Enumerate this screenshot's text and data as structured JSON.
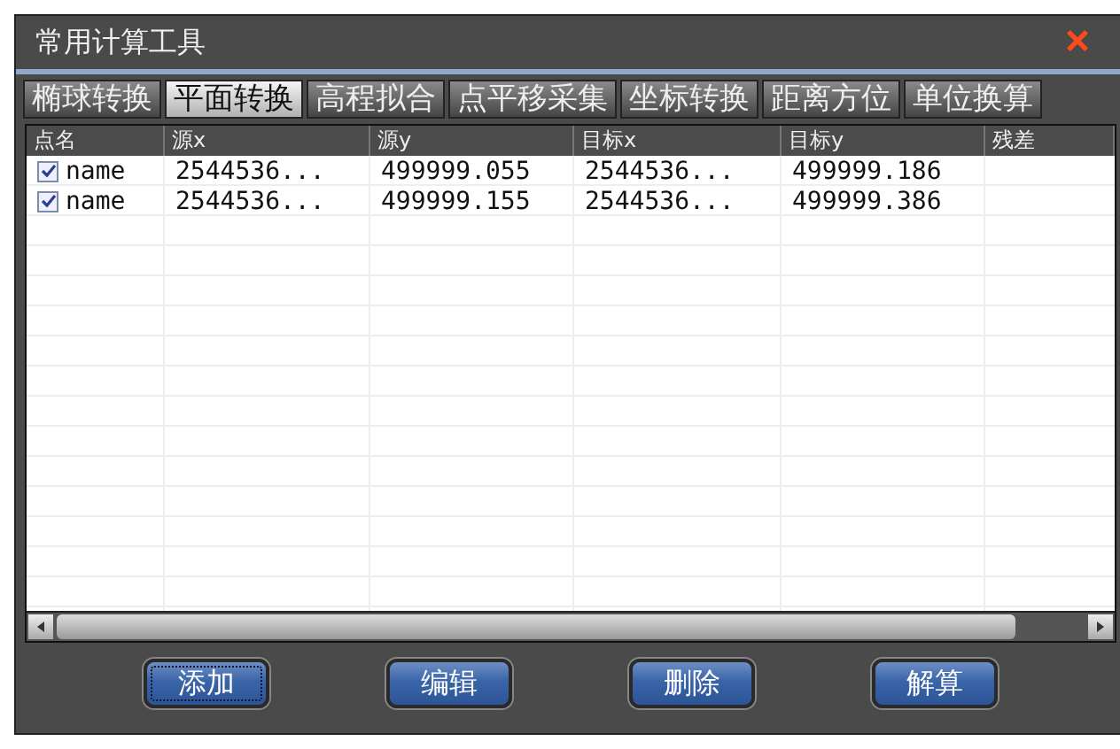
{
  "window": {
    "title": "常用计算工具",
    "close": "×"
  },
  "tabs": [
    {
      "label": "椭球转换",
      "selected": false
    },
    {
      "label": "平面转换",
      "selected": true
    },
    {
      "label": "高程拟合",
      "selected": false
    },
    {
      "label": "点平移采集",
      "selected": false
    },
    {
      "label": "坐标转换",
      "selected": false
    },
    {
      "label": "距离方位",
      "selected": false
    },
    {
      "label": "单位换算",
      "selected": false
    }
  ],
  "table": {
    "columns": [
      "点名",
      "源x",
      "源y",
      "目标x",
      "目标y",
      "残差"
    ],
    "rows": [
      {
        "checked": true,
        "cells": [
          "name",
          "2544536...",
          "499999.055",
          "2544536...",
          "499999.186",
          ""
        ]
      },
      {
        "checked": true,
        "cells": [
          "name",
          "2544536...",
          "499999.155",
          "2544536...",
          "499999.386",
          ""
        ]
      }
    ]
  },
  "buttons": [
    {
      "label": "添加",
      "focused": true
    },
    {
      "label": "编辑",
      "focused": false
    },
    {
      "label": "删除",
      "focused": false
    },
    {
      "label": "解算",
      "focused": false
    }
  ]
}
